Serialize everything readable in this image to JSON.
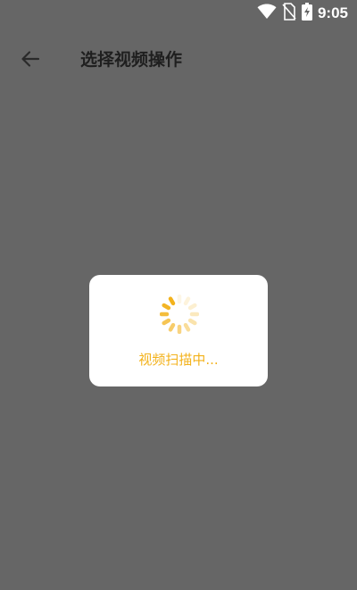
{
  "status_bar": {
    "time": "9:05",
    "icons": [
      "wifi-icon",
      "no-sim-icon",
      "battery-charging-icon"
    ]
  },
  "app_bar": {
    "back_icon": "arrow-left-icon",
    "title": "选择视频操作"
  },
  "loading_dialog": {
    "spinner_icon": "loading-spinner-icon",
    "message": "视频扫描中..."
  },
  "colors": {
    "background_overlay": "#666666",
    "dialog_background": "#ffffff",
    "accent": "#f3b21b",
    "title_text": "#1f1f1f",
    "status_icons": "#ffffff"
  }
}
